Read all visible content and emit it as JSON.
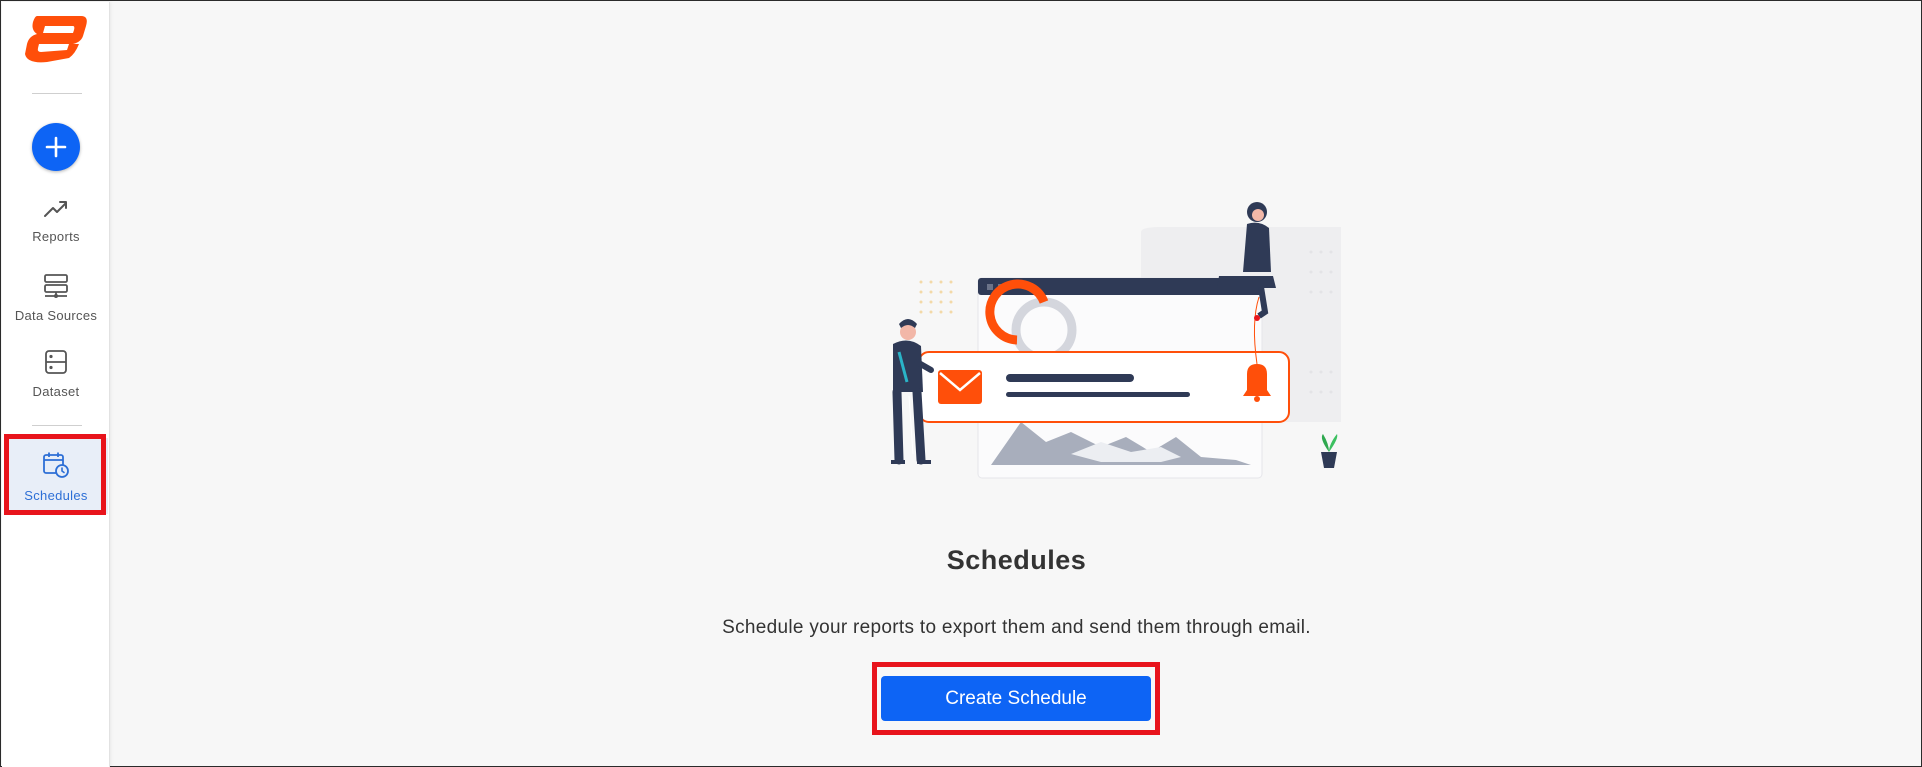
{
  "sidebar": {
    "logo": "app-logo",
    "add_button": {
      "icon": "plus-icon"
    },
    "items": [
      {
        "label": "Reports",
        "icon": "trend-line-icon",
        "active": false
      },
      {
        "label": "Data Sources",
        "icon": "server-stack-icon",
        "active": false
      },
      {
        "label": "Dataset",
        "icon": "dataset-icon",
        "active": false
      },
      {
        "label": "Schedules",
        "icon": "calendar-clock-icon",
        "active": true
      }
    ]
  },
  "main": {
    "illustration": "schedule-email-illustration",
    "title": "Schedules",
    "description": "Schedule your reports to export them and send them through email.",
    "create_button": "Create Schedule"
  },
  "colors": {
    "accent": "#0d64f5",
    "brand": "#ff4f0a",
    "highlight": "#e8141c",
    "active_nav_bg": "#e8eef8"
  }
}
